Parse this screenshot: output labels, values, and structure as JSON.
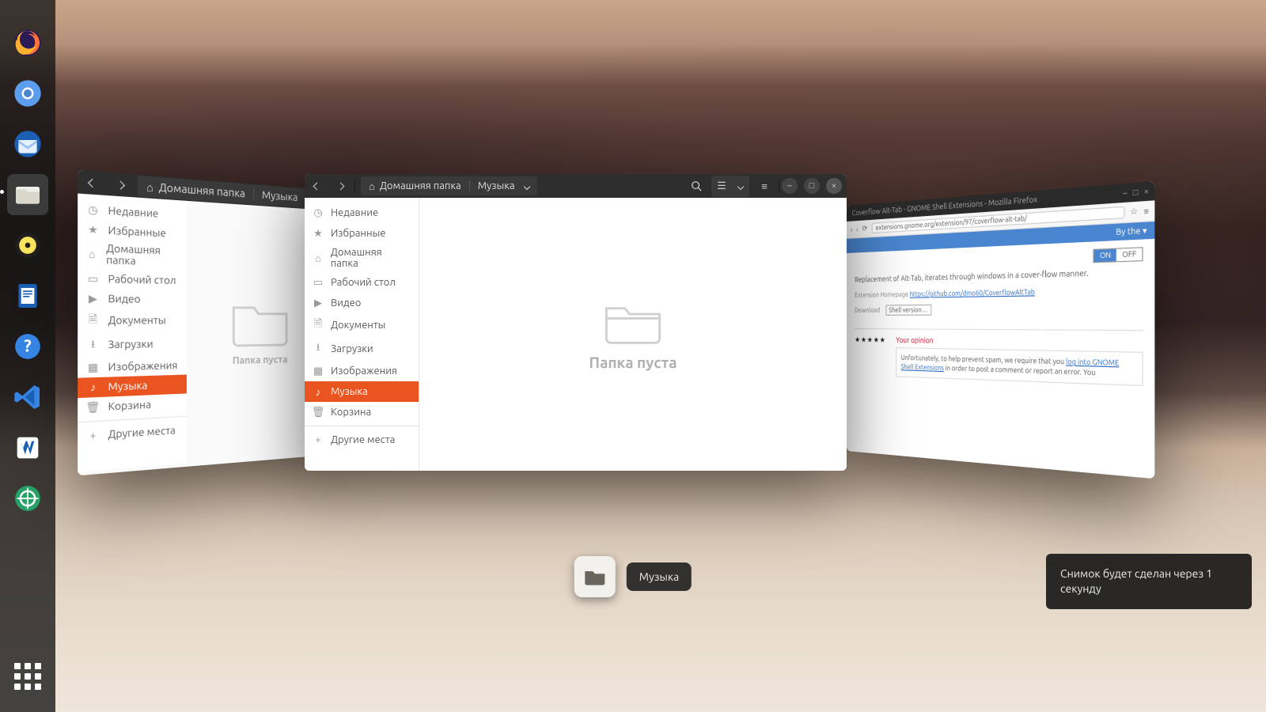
{
  "dock": {
    "items": [
      {
        "name": "firefox"
      },
      {
        "name": "chromium"
      },
      {
        "name": "thunderbird"
      },
      {
        "name": "files",
        "active": true
      },
      {
        "name": "rhythmbox"
      },
      {
        "name": "libreoffice-writer"
      },
      {
        "name": "help"
      },
      {
        "name": "vscode"
      },
      {
        "name": "virtualbox"
      },
      {
        "name": "remmina"
      }
    ]
  },
  "nautilus": {
    "home_label": "Домашняя папка",
    "path_current": "Музыка",
    "empty_msg": "Папка пуста",
    "sidebar": [
      {
        "icon": "clock",
        "label": "Недавние"
      },
      {
        "icon": "star",
        "label": "Избранные"
      },
      {
        "icon": "home",
        "label": "Домашняя папка"
      },
      {
        "icon": "desktop",
        "label": "Рабочий стол"
      },
      {
        "icon": "video",
        "label": "Видео"
      },
      {
        "icon": "doc",
        "label": "Документы"
      },
      {
        "icon": "download",
        "label": "Загрузки"
      },
      {
        "icon": "image",
        "label": "Изображения"
      },
      {
        "icon": "music",
        "label": "Музыка",
        "selected": true
      },
      {
        "icon": "trash",
        "label": "Корзина"
      },
      {
        "sep": true
      },
      {
        "icon": "plus",
        "label": "Другие места"
      }
    ]
  },
  "firefox_win": {
    "title": "Coverflow Alt-Tab - GNOME Shell Extensions - Mozilla Firefox",
    "url": "extensions.gnome.org/extension/97/coverflow-alt-tab/",
    "banner_menu": "By the ▾",
    "toggle_on": "ON",
    "toggle_off": "OFF",
    "desc": "Replacement of Alt-Tab, iterates through windows in a cover-flow manner.",
    "ext_line_label": "Extension Homepage",
    "ext_link": "https://github.com/dmo60/CoverflowAltTab",
    "download_label": "Download",
    "download_value": "Shell version…",
    "review_heading": "Your opinion",
    "review_body_1": "Unfortunately, to help prevent spam, we require that you ",
    "review_link": "log into GNOME Shell Extensions",
    "review_body_2": " in order to post a comment or report an error. You"
  },
  "switcher": {
    "active_app_label": "Музыка"
  },
  "notification": {
    "text": "Снимок будет сделан через 1 секунду"
  }
}
